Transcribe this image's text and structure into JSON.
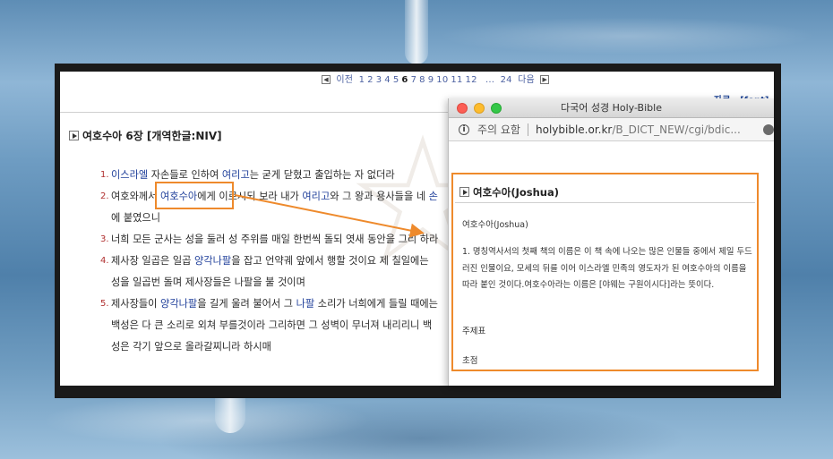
{
  "pager": {
    "prev_label": "이전",
    "pages": [
      "1",
      "2",
      "3",
      "4",
      "5",
      "6",
      "7",
      "8",
      "9",
      "10",
      "11",
      "12"
    ],
    "current_page": "6",
    "ellipsis": "...",
    "last_page": "24",
    "next_label": "다음"
  },
  "right_header": "자료 · [font]",
  "chapter": {
    "title": "여호수아 6장 [개역한글:NIV]"
  },
  "verses": [
    {
      "num": "1.",
      "parts": [
        {
          "t": "이스라엘",
          "link": true
        },
        {
          "t": " 자손들로 인하여 "
        },
        {
          "t": "여리고",
          "link": true
        },
        {
          "t": "는 굳게 닫혔고 출입하는 자 없더라"
        }
      ]
    },
    {
      "num": "2.",
      "parts": [
        {
          "t": "여호와께서 "
        },
        {
          "t": "여호수아",
          "link": true
        },
        {
          "t": "에게 이르시되 보라 내가 "
        },
        {
          "t": "여리고",
          "link": true
        },
        {
          "t": "와 그 왕과 용사들을 네 "
        },
        {
          "t": "손",
          "link": true
        },
        {
          "t": "에 붙였으니"
        }
      ]
    },
    {
      "num": "3.",
      "parts": [
        {
          "t": "너희 모든 군사는 성을 둘러 성 주위를 매일 한번씩 돌되 엿새 동안을 그리 하라"
        }
      ]
    },
    {
      "num": "4.",
      "parts": [
        {
          "t": "제사장 일곱은 일곱 "
        },
        {
          "t": "양각나팔",
          "link": true
        },
        {
          "t": "을 잡고 언약궤 앞에서 행할 것이요 제 칠일에는 성을 일곱번 돌며 제사장들은 나팔을 불 것이며"
        }
      ]
    },
    {
      "num": "5.",
      "parts": [
        {
          "t": "제사장들이 "
        },
        {
          "t": "양각나팔",
          "link": true
        },
        {
          "t": "을 길게 울려 불어서 그 "
        },
        {
          "t": "나팔",
          "link": true
        },
        {
          "t": " 소리가 너희에게 들릴 때에는 백성은 다 큰 소리로 외쳐 부를것이라 그리하면 그 성벽이 무너져 내리리니 백성은 각기 앞으로 올라갈찌니라 하시매"
        }
      ]
    }
  ],
  "popup": {
    "window_title": "다국어 성경 Holy-Bible",
    "security_label": "주의 요함",
    "url_domain": "holybible.or.kr",
    "url_path": "/B_DICT_NEW/cgi/bdic...",
    "entry_title": "여호수아(Joshua)",
    "entry_subtitle": "여호수아(Joshua)",
    "entry_definition": "1. 명칭역사서의 첫째 책의 이름은 이 책 속에 나오는 많은 인물들 중에서 제일 두드러진 인물이요, 모세의 뒤를 이어 이스라엘 민족의 영도자가 된 여호수아의 이름을 따라 붙인 것이다.여호수아라는 이름은 [야웨는 구원이시다]라는 뜻이다.",
    "section_1": "주제표",
    "section_2": "초점"
  },
  "colors": {
    "highlight": "#ee8a2c",
    "link": "#1f3f9a",
    "verse_number": "#b03030"
  }
}
